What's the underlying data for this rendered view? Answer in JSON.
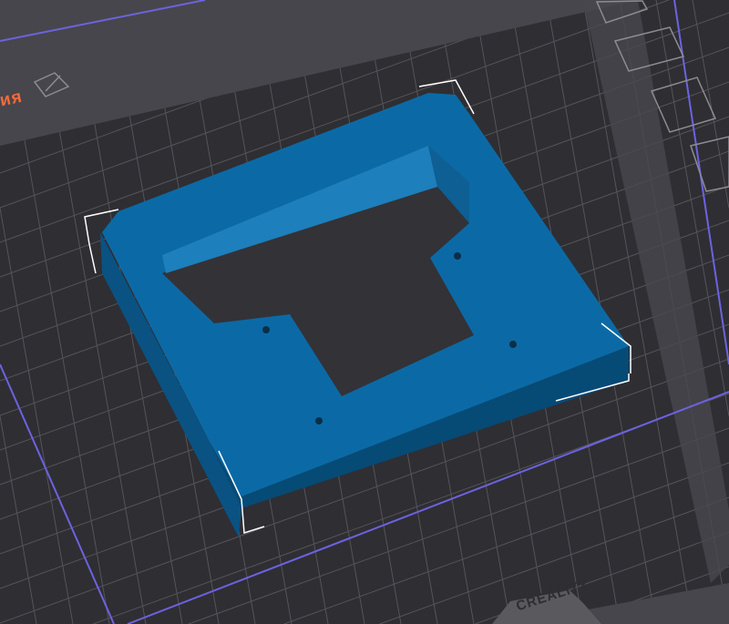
{
  "viewport": {
    "tab_label_fragment": "ия",
    "plate_brand": "CREALITY",
    "model_color": "#0b6aa5",
    "plate_color": "#2f2e33",
    "boundary_color": "#6b63e0"
  }
}
